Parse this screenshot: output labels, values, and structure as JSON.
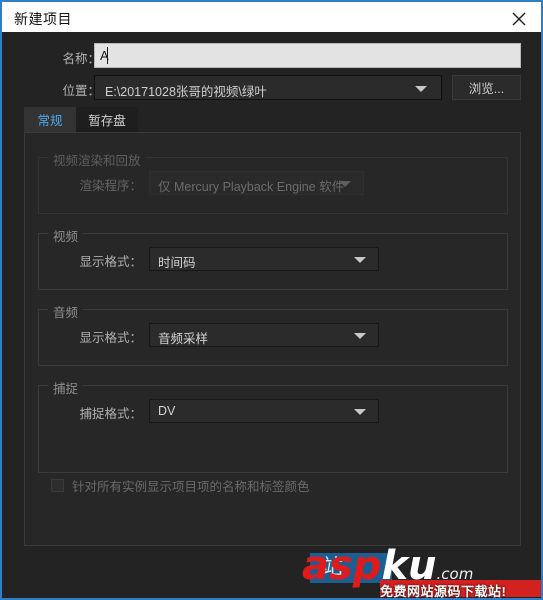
{
  "window": {
    "title": "新建项目",
    "close_icon": "close-icon",
    "accent_border": "#2f7fc4",
    "titlebar_bg": "#ffffff",
    "body_bg": "#232323"
  },
  "fields": {
    "name": {
      "label": "名称：",
      "value": "A",
      "placeholder": ""
    },
    "location": {
      "label": "位置：",
      "value": "E:\\20171028张哥的视频\\绿叶",
      "caret_icon": "chevron-down-icon"
    },
    "browse_label": "浏览..."
  },
  "tabs": [
    {
      "label": "常规",
      "active": true,
      "active_color": "#50a8e8"
    },
    {
      "label": "暂存盘",
      "active": false
    }
  ],
  "groups": [
    {
      "title": "视频渲染和回放",
      "disabled": true,
      "row_label": "渲染程序：",
      "value": "仅 Mercury Playback Engine 软件"
    },
    {
      "title": "视频",
      "disabled": false,
      "row_label": "显示格式：",
      "value": "时间码"
    },
    {
      "title": "音频",
      "disabled": false,
      "row_label": "显示格式：",
      "value": "音频采样"
    },
    {
      "title": "捕捉",
      "disabled": false,
      "row_label": "捕捉格式：",
      "value": "DV"
    }
  ],
  "checkbox": {
    "label": "针对所有实例显示项目项的名称和标签颜色",
    "checked": false,
    "disabled": true
  },
  "watermark": {
    "part_red": "asp",
    "part_white": "ku",
    "part_tld": ".com",
    "subtitle": "免费网站源码下载站!",
    "badge_glyph": "站",
    "red": "#e01b1b",
    "blue": "#1b5e92"
  }
}
